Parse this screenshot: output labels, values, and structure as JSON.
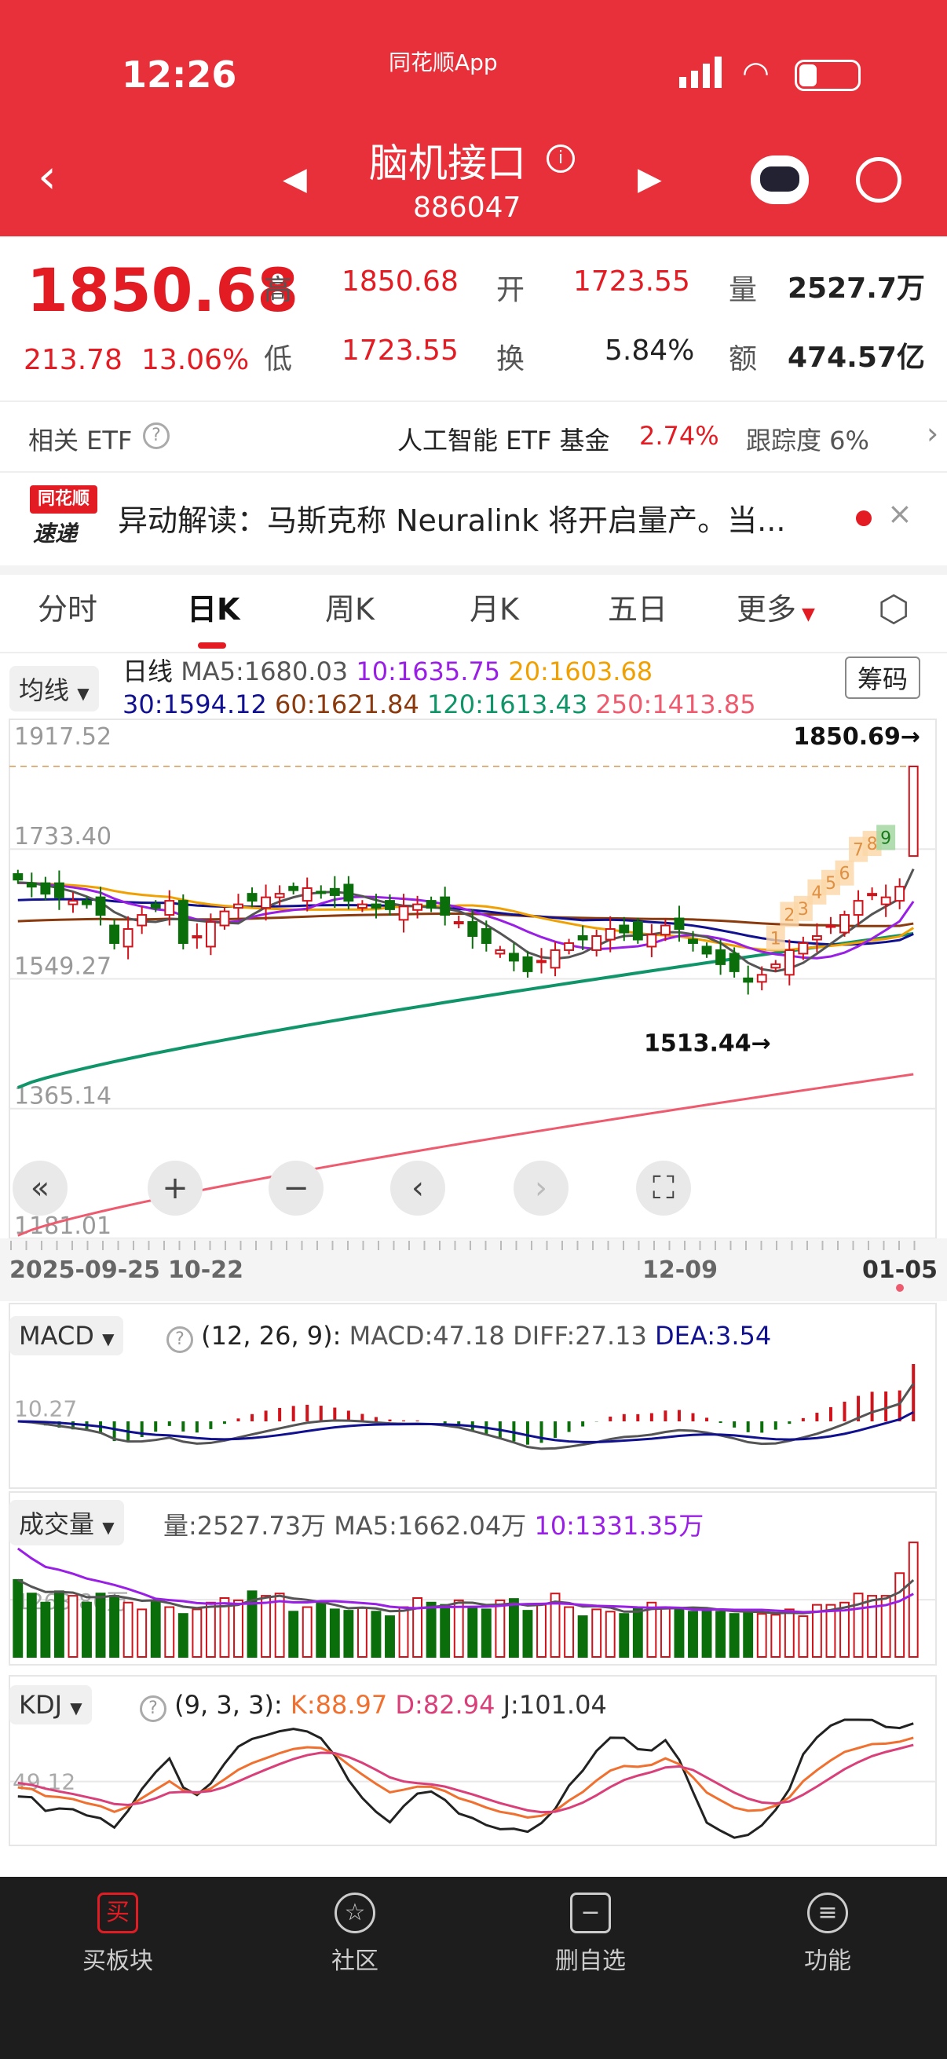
{
  "status": {
    "time": "12:26",
    "app": "同花顺App"
  },
  "header": {
    "title": "脑机接口",
    "code": "886047"
  },
  "quote": {
    "price": "1850.68",
    "change": "213.78",
    "pct": "13.06%",
    "high_label": "高",
    "high": "1850.68",
    "low_label": "低",
    "low": "1723.55",
    "open_label": "开",
    "open": "1723.55",
    "turn_label": "换",
    "turn": "5.84%",
    "vol_label": "量",
    "vol": "2527.7万",
    "amt_label": "额",
    "amt": "474.57亿"
  },
  "etf": {
    "label": "相关 ETF",
    "name": "人工智能 ETF 基金",
    "pct": "2.74%",
    "track": "跟踪度 6%"
  },
  "news": {
    "logo_top": "同花顺",
    "logo_bottom": "速递",
    "text": "异动解读：马斯克称 Neuralink 将开启量产。当..."
  },
  "tabs": [
    "分时",
    "日K",
    "周K",
    "月K",
    "五日",
    "更多"
  ],
  "ma": {
    "selector": "均线",
    "period": "日线",
    "ma5": "MA5:1680.03",
    "ma10": "10:1635.75",
    "ma20": "20:1603.68",
    "ma30": "30:1594.12",
    "ma60": "60:1621.84",
    "ma120": "120:1613.43",
    "ma250": "250:1413.85",
    "chip": "筹码"
  },
  "colors": {
    "ma5": "#555555",
    "ma10": "#9a1fe6",
    "ma20": "#f0a000",
    "ma30": "#101090",
    "ma60": "#8b3a0e",
    "ma120": "#10956a",
    "ma250": "#ee5a6e",
    "up": "#d0131b",
    "down": "#0a6e0a"
  },
  "chart_data": {
    "type": "candlestick",
    "yticks": [
      "1917.52",
      "1733.40",
      "1549.27",
      "1365.14",
      "1181.01"
    ],
    "ylim": [
      1181.01,
      1917.52
    ],
    "max_label": "1850.69→",
    "min_label": "1513.44→",
    "dates": [
      "2025-09-25",
      "10-22",
      "12-09",
      "01-05"
    ],
    "closes": [
      1690,
      1680,
      1670,
      1665,
      1660,
      1655,
      1640,
      1600,
      1620,
      1640,
      1650,
      1660,
      1600,
      1610,
      1630,
      1645,
      1655,
      1660,
      1665,
      1670,
      1675,
      1678,
      1672,
      1668,
      1660,
      1655,
      1650,
      1648,
      1652,
      1655,
      1650,
      1640,
      1630,
      1610,
      1600,
      1590,
      1575,
      1560,
      1575,
      1590,
      1600,
      1605,
      1610,
      1620,
      1615,
      1605,
      1612,
      1625,
      1620,
      1600,
      1585,
      1570,
      1560,
      1545,
      1555,
      1570,
      1590,
      1600,
      1610,
      1625,
      1640,
      1660,
      1670,
      1665,
      1680,
      1850.68
    ],
    "last_open": 1723.55,
    "ma120_range": [
      1395,
      1613.43
    ],
    "ma250_range": [
      1185,
      1413.85
    ],
    "nine_count": [
      "1",
      "2",
      "3",
      "4",
      "5",
      "6",
      "7",
      "8",
      "9"
    ],
    "volume": [
      1700,
      1400,
      1200,
      1450,
      1350,
      1200,
      1400,
      1350,
      1200,
      1050,
      1250,
      1100,
      950,
      1050,
      1200,
      1300,
      1250,
      1450,
      1350,
      1400,
      1000,
      1100,
      1200,
      1050,
      1020,
      1080,
      1000,
      900,
      1100,
      1300,
      1200,
      1150,
      1250,
      1080,
      1050,
      1250,
      1280,
      1020,
      1150,
      1400,
      1100,
      900,
      1050,
      1000,
      950,
      1100,
      1200,
      1100,
      1050,
      1000,
      1050,
      1000,
      950,
      1000,
      950,
      930,
      1050,
      900,
      1150,
      1150,
      1200,
      1400,
      1350,
      1350,
      1850,
      2527.73
    ],
    "vol_mid_label": "1263.86万",
    "macd_label": "10.27",
    "kdj_label": "49.12"
  },
  "macd": {
    "selector": "MACD",
    "params": "(12, 26, 9):",
    "macd": "MACD:47.18",
    "diff": "DIFF:27.13",
    "dea": "DEA:3.54"
  },
  "volp": {
    "selector": "成交量",
    "vol": "量:2527.73万",
    "ma5": "MA5:1662.04万",
    "ma10": "10:1331.35万"
  },
  "kdj": {
    "selector": "KDJ",
    "params": "(9, 3, 3):",
    "k": "K:88.97",
    "d": "D:82.94",
    "j": "J:101.04"
  },
  "nav": [
    "买板块",
    "社区",
    "删自选",
    "功能"
  ]
}
